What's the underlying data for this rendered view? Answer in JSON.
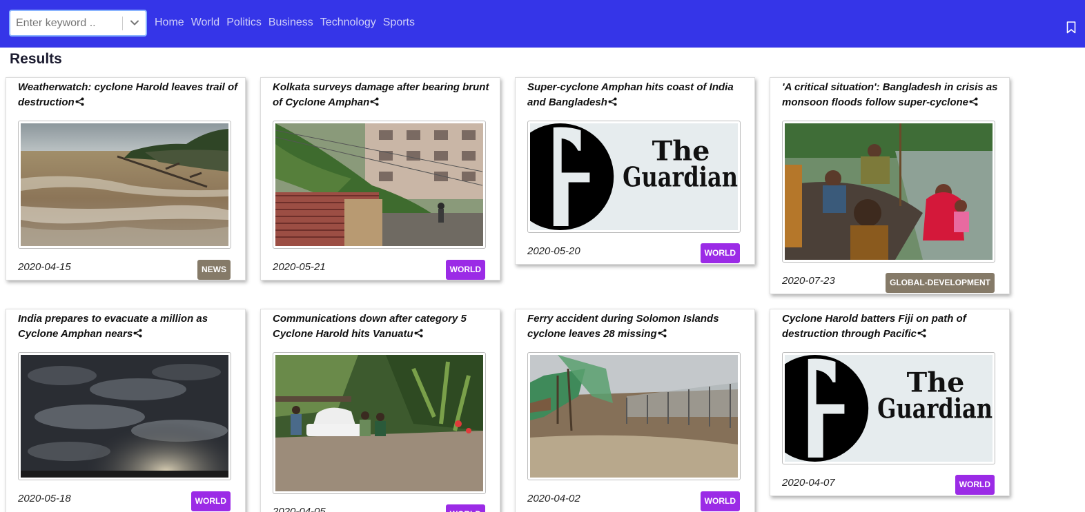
{
  "search": {
    "placeholder": "Enter keyword .."
  },
  "nav": {
    "links": [
      "Home",
      "World",
      "Politics",
      "Business",
      "Technology",
      "Sports"
    ]
  },
  "results": {
    "heading": "Results",
    "cards": [
      {
        "title": "Weatherwatch: cyclone Harold leaves trail of destruction",
        "date": "2020-04-15",
        "section": "NEWS",
        "image": "stormy-sea-photo"
      },
      {
        "title": "Kolkata surveys damage after bearing brunt of Cyclone Amphan",
        "date": "2020-05-21",
        "section": "WORLD",
        "image": "fallen-tree-street-photo"
      },
      {
        "title": "Super-cyclone Amphan hits coast of India and Bangladesh",
        "date": "2020-05-20",
        "section": "WORLD",
        "image": "guardian-logo"
      },
      {
        "title": "'A critical situation': Bangladesh in crisis as monsoon floods follow super-cyclone",
        "date": "2020-07-23",
        "section": "GLOBAL-DEVELOPMENT",
        "image": "flood-boat-photo"
      },
      {
        "title": "India prepares to evacuate a million as Cyclone Amphan nears",
        "date": "2020-05-18",
        "section": "WORLD",
        "image": "dark-clouds-photo"
      },
      {
        "title": "Communications down after category 5 Cyclone Harold hits Vanuatu",
        "date": "2020-04-05",
        "section": "WORLD",
        "image": "flooded-car-photo"
      },
      {
        "title": "Ferry accident during Solomon Islands cyclone leaves 28 missing",
        "date": "2020-04-02",
        "section": "WORLD",
        "image": "damaged-fence-photo"
      },
      {
        "title": "Cyclone Harold batters Fiji on path of destruction through Pacific",
        "date": "2020-04-07",
        "section": "WORLD",
        "image": "guardian-logo"
      }
    ]
  },
  "guardian_logo": {
    "line1": "The",
    "line2": "Guardian"
  },
  "colors": {
    "navbar": "#3535e8",
    "badge_world": "#9b2be6",
    "badge_news": "#857a68"
  }
}
